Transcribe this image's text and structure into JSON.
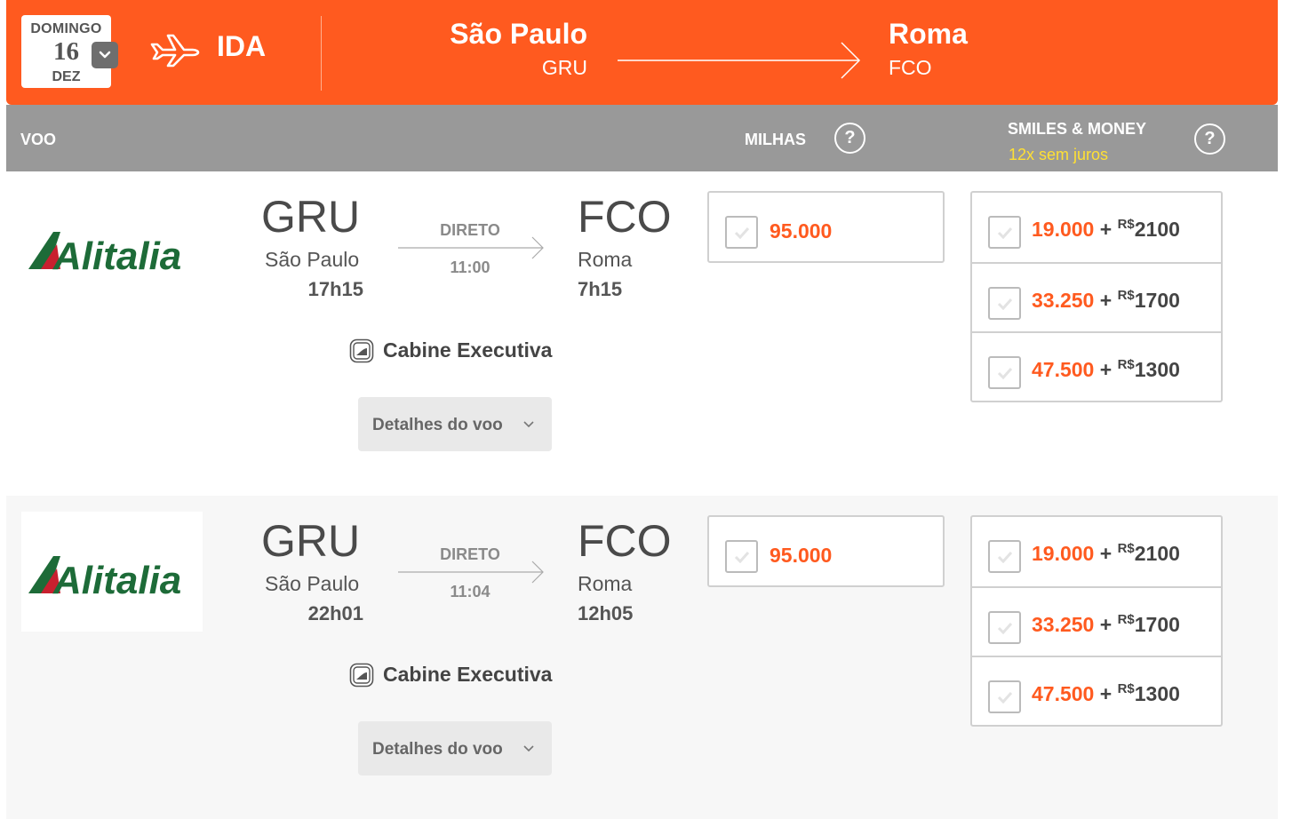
{
  "header": {
    "weekday": "DOMINGO",
    "day": "16",
    "month": "DEZ",
    "direction": "IDA",
    "origin_city": "São Paulo",
    "origin_code": "GRU",
    "dest_city": "Roma",
    "dest_code": "FCO",
    "icons": [
      "chevron-down-icon",
      "plane-icon",
      "route-arrow-icon"
    ],
    "color": "#ff5a1f"
  },
  "columns": {
    "voo": "VOO",
    "milhas": "MILHAS",
    "smiles": "SMILES & MONEY",
    "smiles_sub": "12x sem juros",
    "help": "?"
  },
  "flights": [
    {
      "airline": "Alitalia",
      "from_code": "GRU",
      "from_city": "São Paulo",
      "dep_time": "17h15",
      "stops": "DIRETO",
      "duration": "11:00",
      "to_code": "FCO",
      "to_city": "Roma",
      "arr_time": "7h15",
      "cabin": "Cabine Executiva",
      "details": "Detalhes do voo",
      "miles": "95.000",
      "smiles_money": [
        {
          "miles": "19.000",
          "plus": "+",
          "currency": "R$",
          "money": "2100"
        },
        {
          "miles": "33.250",
          "plus": "+",
          "currency": "R$",
          "money": "1700"
        },
        {
          "miles": "47.500",
          "plus": "+",
          "currency": "R$",
          "money": "1300"
        }
      ]
    },
    {
      "airline": "Alitalia",
      "from_code": "GRU",
      "from_city": "São Paulo",
      "dep_time": "22h01",
      "stops": "DIRETO",
      "duration": "11:04",
      "to_code": "FCO",
      "to_city": "Roma",
      "arr_time": "12h05",
      "cabin": "Cabine Executiva",
      "details": "Detalhes do voo",
      "miles": "95.000",
      "smiles_money": [
        {
          "miles": "19.000",
          "plus": "+",
          "currency": "R$",
          "money": "2100"
        },
        {
          "miles": "33.250",
          "plus": "+",
          "currency": "R$",
          "money": "1700"
        },
        {
          "miles": "47.500",
          "plus": "+",
          "currency": "R$",
          "money": "1300"
        }
      ]
    }
  ]
}
